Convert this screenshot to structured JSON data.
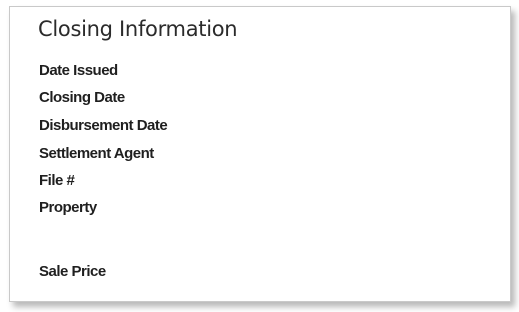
{
  "section": {
    "title": "Closing Information",
    "fields": [
      {
        "label": "Date Issued",
        "value": ""
      },
      {
        "label": "Closing Date",
        "value": ""
      },
      {
        "label": "Disbursement Date",
        "value": ""
      },
      {
        "label": "Settlement Agent",
        "value": ""
      },
      {
        "label": "File #",
        "value": ""
      },
      {
        "label": "Property",
        "value": ""
      },
      {
        "label": "Sale Price",
        "value": ""
      }
    ]
  }
}
